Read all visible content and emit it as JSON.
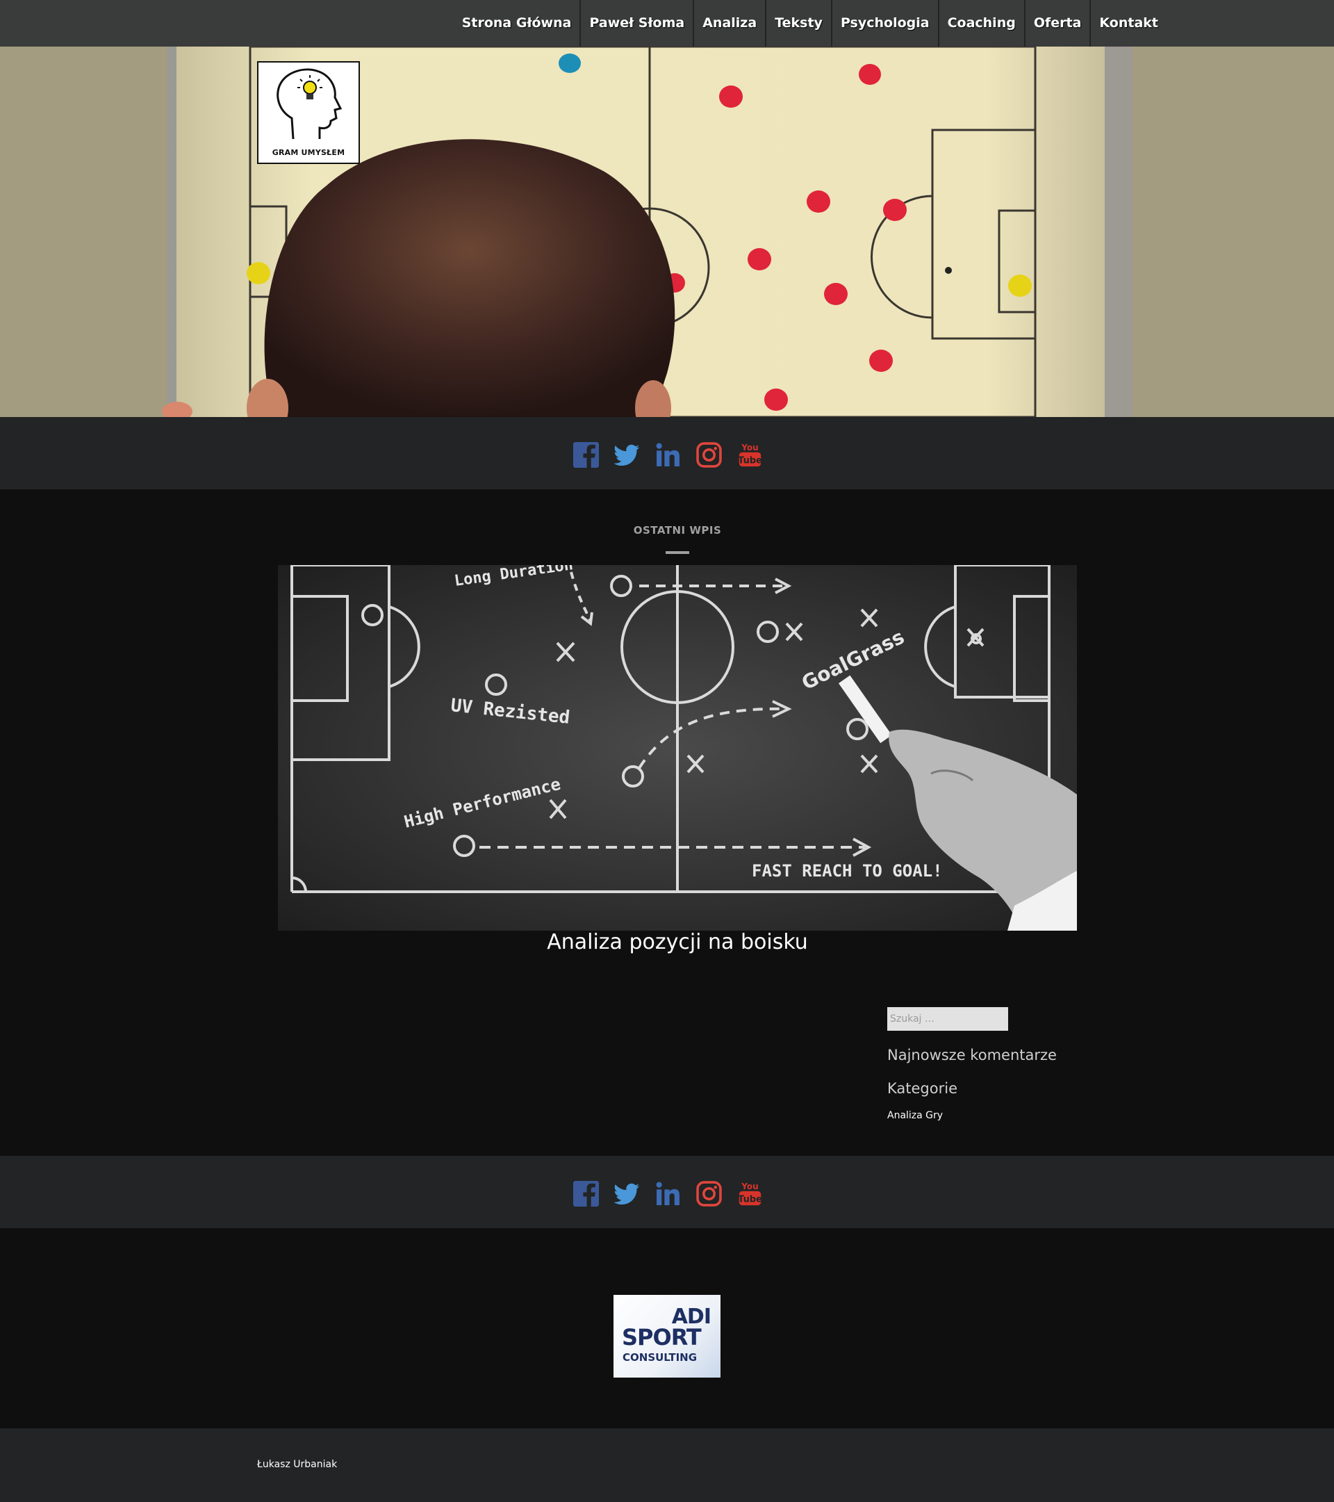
{
  "nav": {
    "items": [
      {
        "label": "Strona Główna"
      },
      {
        "label": "Paweł Słoma"
      },
      {
        "label": "Analiza"
      },
      {
        "label": "Teksty"
      },
      {
        "label": "Psychologia"
      },
      {
        "label": "Coaching"
      },
      {
        "label": "Oferta"
      },
      {
        "label": "Kontakt"
      }
    ]
  },
  "header": {
    "logo_text": "GRAM UMYSŁEM"
  },
  "social": {
    "icons": [
      "facebook-icon",
      "twitter-icon",
      "linkedin-icon",
      "instagram-icon",
      "youtube-icon"
    ],
    "colors": {
      "facebook": "#3b5998",
      "twitter": "#4a97d9",
      "linkedin": "#3d6bb5",
      "instagram": "#e0463d",
      "youtube": "#d8342b"
    }
  },
  "main": {
    "section_label": "OSTATNI WPIS",
    "post_image_texts": [
      "Long Duration",
      "UV Rezisted",
      "High Performance",
      "GoalGrass",
      "FAST REACH TO GOAL!"
    ],
    "post_title": "Analiza pozycji na boisku"
  },
  "sidebar": {
    "search_placeholder": "Szukaj …",
    "recent_comments_title": "Najnowsze komentarze",
    "categories_title": "Kategorie",
    "categories": [
      "Analiza Gry"
    ]
  },
  "sponsor": {
    "line1": "ADI",
    "line2": "SPORT",
    "line3": "CONSULTING"
  },
  "footer": {
    "text": "Łukasz Urbaniak"
  }
}
